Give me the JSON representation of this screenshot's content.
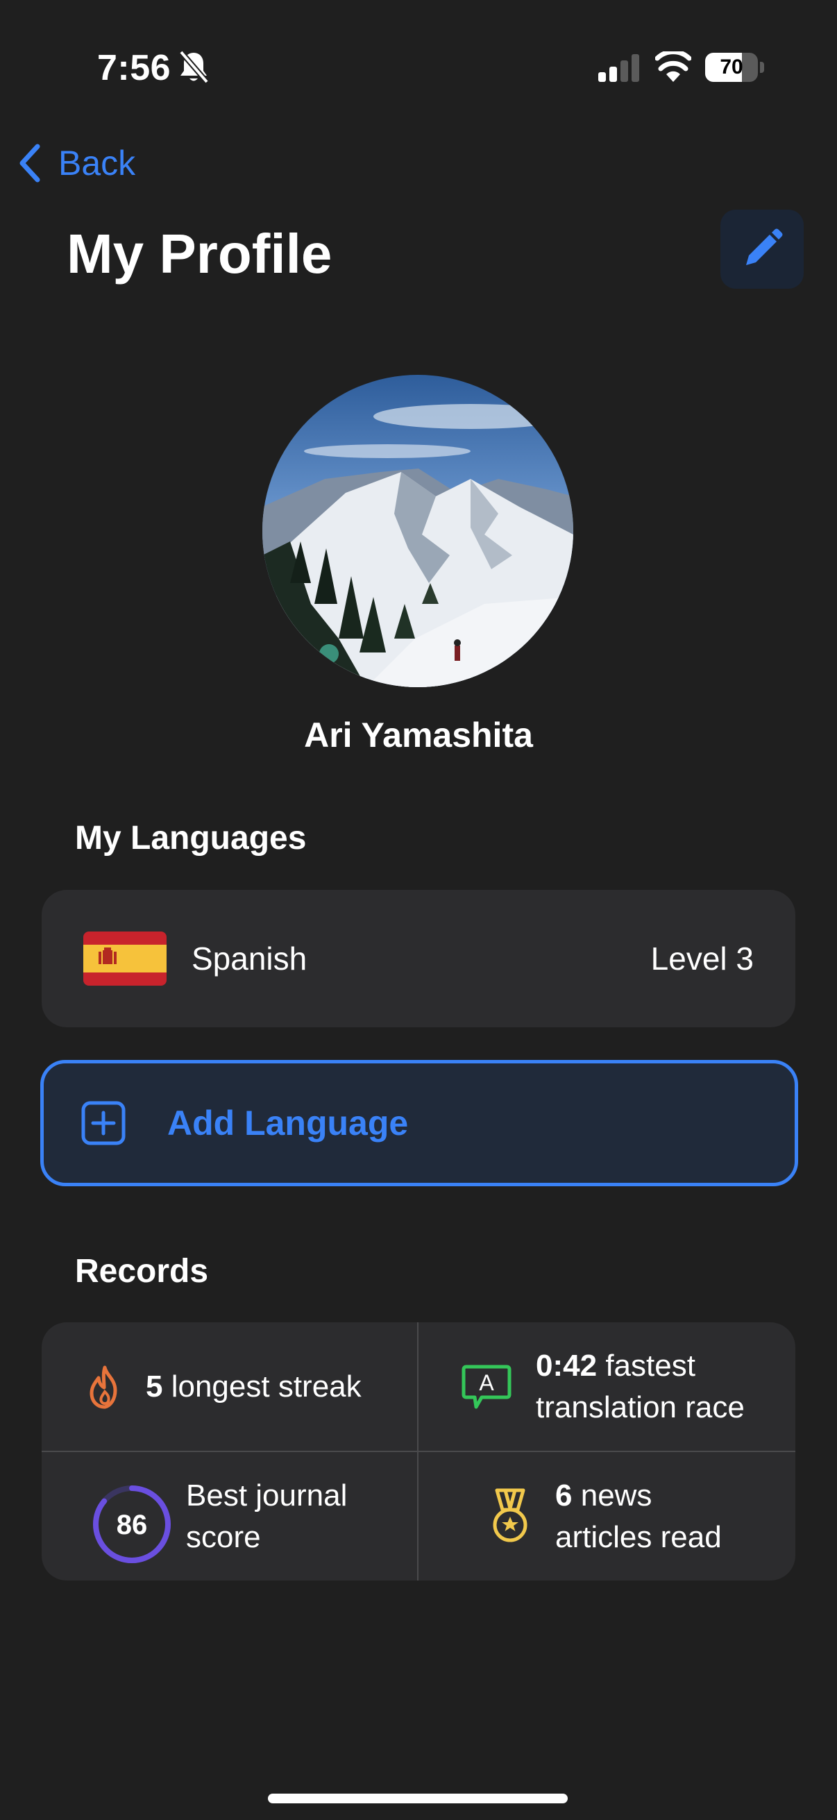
{
  "status_bar": {
    "time": "7:56",
    "battery_percent": 70,
    "battery_label": "70",
    "icons": [
      "bell-slash-icon",
      "cellular-signal-icon",
      "wifi-icon",
      "battery-icon"
    ]
  },
  "nav": {
    "back_label": "Back",
    "title": "My Profile",
    "edit_icon": "pencil-icon"
  },
  "profile": {
    "name": "Ari Yamashita",
    "avatar": "mountain-photo"
  },
  "languages": {
    "heading": "My Languages",
    "items": [
      {
        "name": "Spanish",
        "level": "Level 3",
        "flag": "spain-flag-icon"
      }
    ],
    "add_label": "Add Language"
  },
  "records": {
    "heading": "Records",
    "items": [
      {
        "value": "5",
        "text": "longest streak",
        "icon": "flame-icon",
        "color": "#e8743b"
      },
      {
        "value": "0:42",
        "text": "fastest",
        "text2": "translation race",
        "icon": "translate-bubble-icon",
        "color": "#34c759"
      },
      {
        "value": "86",
        "text": "Best journal",
        "text2": "score",
        "icon": "score-ring-icon",
        "color": "#6a4fe0"
      },
      {
        "value": "6",
        "text": "news",
        "text2": "articles read",
        "icon": "medal-icon",
        "color": "#f2c94c"
      }
    ]
  },
  "colors": {
    "accent": "#3a82f7",
    "background": "#1f1f1f",
    "card": "#2c2c2e"
  }
}
